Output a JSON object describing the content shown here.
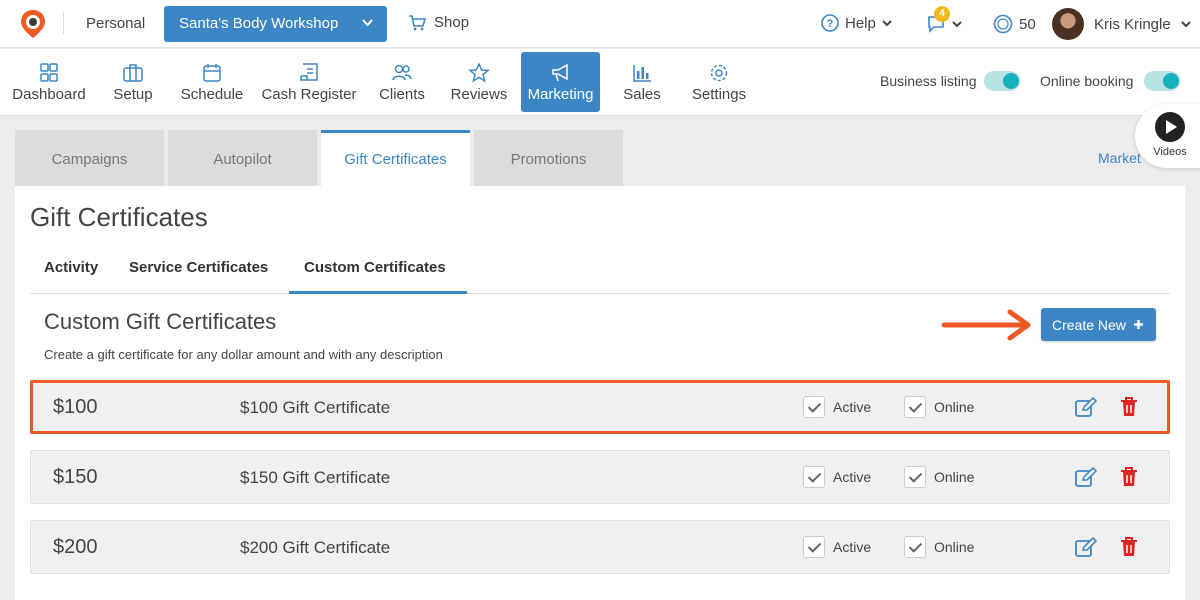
{
  "topbar": {
    "personal_label": "Personal",
    "business_name": "Santa's Body Workshop",
    "shop_label": "Shop",
    "help_label": "Help",
    "notification_count": "4",
    "points": "50",
    "user_name": "Kris Kringle"
  },
  "nav": {
    "items": [
      {
        "label": "Dashboard",
        "icon": "dashboard-icon"
      },
      {
        "label": "Setup",
        "icon": "briefcase-icon"
      },
      {
        "label": "Schedule",
        "icon": "calendar-icon"
      },
      {
        "label": "Cash Register",
        "icon": "receipt-icon"
      },
      {
        "label": "Clients",
        "icon": "clients-icon"
      },
      {
        "label": "Reviews",
        "icon": "star-icon"
      },
      {
        "label": "Marketing",
        "icon": "megaphone-icon",
        "active": true
      },
      {
        "label": "Sales",
        "icon": "bar-chart-icon"
      },
      {
        "label": "Settings",
        "icon": "gear-icon"
      }
    ],
    "business_listing_label": "Business listing",
    "business_listing_on": true,
    "online_booking_label": "Online booking",
    "online_booking_on": true
  },
  "tabs": [
    {
      "label": "Campaigns"
    },
    {
      "label": "Autopilot"
    },
    {
      "label": "Gift Certificates",
      "active": true
    },
    {
      "label": "Promotions"
    }
  ],
  "market_link": "Market",
  "videos_label": "Videos",
  "page": {
    "title": "Gift Certificates",
    "subtabs": [
      {
        "label": "Activity"
      },
      {
        "label": "Service Certificates"
      },
      {
        "label": "Custom Certificates",
        "active": true
      }
    ],
    "section_title": "Custom Gift Certificates",
    "section_desc": "Create a gift certificate for any dollar amount and with any description",
    "create_button": "Create New",
    "rows": [
      {
        "amount": "$100",
        "description": "$100 Gift Certificate",
        "active_label": "Active",
        "online_label": "Online",
        "active": true,
        "online": true,
        "highlighted": true
      },
      {
        "amount": "$150",
        "description": "$150 Gift Certificate",
        "active_label": "Active",
        "online_label": "Online",
        "active": true,
        "online": true
      },
      {
        "amount": "$200",
        "description": "$200 Gift Certificate",
        "active_label": "Active",
        "online_label": "Online",
        "active": true,
        "online": true
      }
    ]
  },
  "colors": {
    "primary": "#3d86c6",
    "highlight": "#ee5a24",
    "toggle_on": "#15b2bd",
    "delete": "#e02424"
  }
}
